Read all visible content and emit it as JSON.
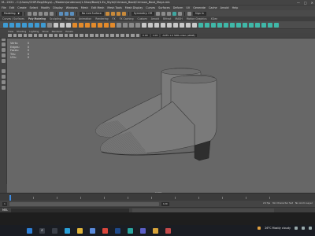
{
  "window": {
    "title": "M...2021 - C:/Users/CHIP-Rep/Maya/.../Modem/anderson/1.Shoe/Boot/1.Ex_Style/Crimson_Boot/Crimson_Boot_Maya.mb",
    "controls": [
      "—",
      "□",
      "✕"
    ]
  },
  "menubar": {
    "items": [
      "File",
      "Edit",
      "Create",
      "Select",
      "Modify",
      "Display",
      "Windows",
      "Mesh",
      "Edit Mesh",
      "Mesh Tools",
      "Mesh Display",
      "Curves",
      "Surfaces",
      "Deform",
      "UV",
      "Generate",
      "Cache",
      "Arnold",
      "Help"
    ]
  },
  "statusline": {
    "mode": "Modeling",
    "object_mode": "No Live Surface",
    "symmetry": "Symmetry: Off",
    "sign_in": "Sign In"
  },
  "shelf_tabs": {
    "items": [
      "Curves / Surfaces",
      "Poly Modeling",
      "Sculpting",
      "Rigging",
      "Animation",
      "Rendering",
      "FX",
      "FX Caching",
      "Custom",
      "Arnold",
      "Bifrost",
      "MASH",
      "Motion Graphics",
      "XGen"
    ],
    "active_index": 1
  },
  "panel_menu": {
    "items": [
      "View",
      "Shading",
      "Lighting",
      "Show",
      "Renderer",
      "Panels"
    ]
  },
  "panel_toolbar": {
    "field_1": "0.00",
    "field_2": "1.00",
    "color_space": "ACES 1.0 SDR-video (sRGB)"
  },
  "viewport": {
    "hud_labels": [
      "Verts:",
      "Edges:",
      "Faces:",
      "Tris:",
      "UVs:"
    ],
    "hud_values": [
      "0",
      "0",
      "0",
      "0",
      "0"
    ],
    "camera_label": "persp",
    "background": "#676767",
    "object": "Crimson boot pair (wireframe mesh)"
  },
  "time_slider": {
    "current_frame": 1
  },
  "range_slider": {
    "start": "1",
    "end": "120",
    "fps": "24 fps",
    "character_set": "No Character Set",
    "anim_layer": "No Anim Layer"
  },
  "command_line": {
    "tag": "MEL"
  },
  "taskbar": {
    "weather": "26°C Mostly cloudy",
    "icons": [
      "windows-icon",
      "search-icon",
      "task-view-icon",
      "edge-icon",
      "explorer-icon",
      "store-icon",
      "chrome-icon",
      "photoshop-icon",
      "maya-icon",
      "teams-icon",
      "folder-icon",
      "video-icon"
    ]
  }
}
